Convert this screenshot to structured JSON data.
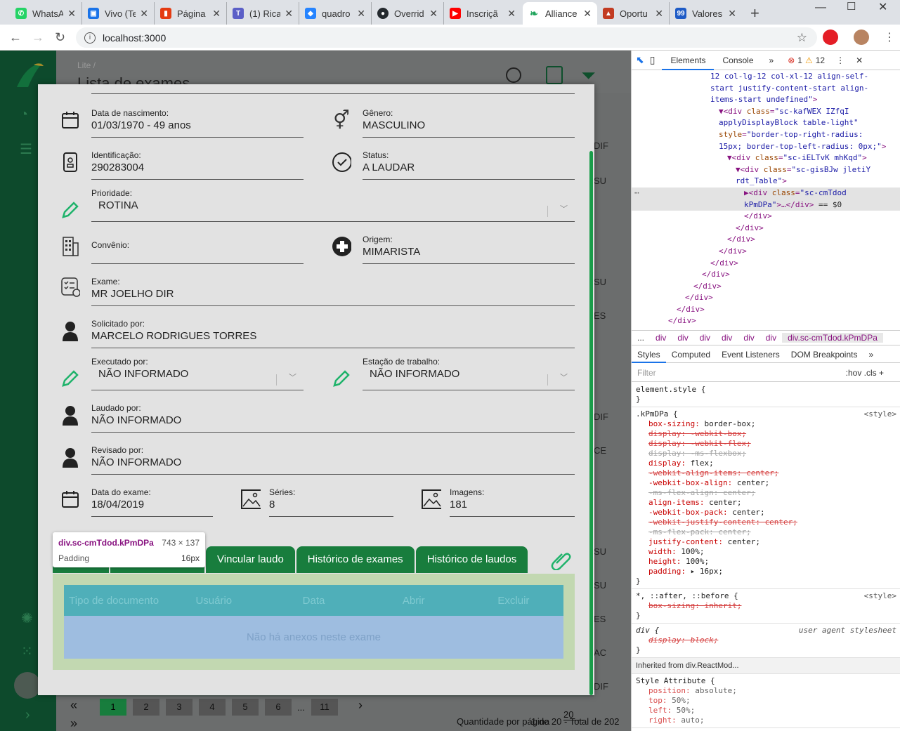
{
  "browser": {
    "tabs": [
      {
        "title": "WhatsA",
        "color": "#25d366",
        "icon": "✆"
      },
      {
        "title": "Vivo (Te",
        "color": "#1a73e8",
        "icon": "▣"
      },
      {
        "title": "Página",
        "color": "#e43b12",
        "icon": "▮"
      },
      {
        "title": "(1) Rica",
        "color": "#5b5fc7",
        "icon": "T"
      },
      {
        "title": "quadro",
        "color": "#2684ff",
        "icon": "◆"
      },
      {
        "title": "Overrid",
        "color": "#24292e",
        "icon": "●"
      },
      {
        "title": "Inscriçã",
        "color": "#ff0000",
        "icon": "▶"
      },
      {
        "title": "Alliance",
        "color": "#1ea35a",
        "icon": "❧"
      },
      {
        "title": "Oportu",
        "color": "#c23b22",
        "icon": "▲"
      },
      {
        "title": "Valores",
        "color": "#1e5bc6",
        "icon": "99"
      }
    ],
    "url": "localhost:3000"
  },
  "page": {
    "breadcrumb": "Lite /",
    "title": "Lista de exames",
    "bg_cells": [
      "DIF",
      "SU",
      "SU",
      "ES",
      "DIF",
      "CE",
      "SU",
      "SU",
      "ES",
      "AC",
      "DIF"
    ],
    "pagination": {
      "prev": "«",
      "next": "»",
      "pages": [
        "1",
        "2",
        "3",
        "4",
        "5",
        "6",
        "...",
        "11"
      ],
      "arrow": "›",
      "quantity_label": "Quantidade por página",
      "quantity_value": "20",
      "total": "1 de 20 - Total de 202"
    }
  },
  "modal": {
    "birth_label": "Data de nascimento:",
    "birth_value": "01/03/1970 - 49 anos",
    "gender_label": "Gênero:",
    "gender_value": "MASCULINO",
    "id_label": "Identificação:",
    "id_value": "290283004",
    "status_label": "Status:",
    "status_value": "A LAUDAR",
    "priority_label": "Prioridade:",
    "priority_value": "ROTINA",
    "insurance_label": "Convênio:",
    "insurance_value": "",
    "origin_label": "Origem:",
    "origin_value": "MIMARISTA",
    "exam_label": "Exame:",
    "exam_value": "MR JOELHO DIR",
    "requested_label": "Solicitado por:",
    "requested_value": "MARCELO RODRIGUES TORRES",
    "executed_label": "Executado por:",
    "executed_value": "NÃO INFORMADO",
    "station_label": "Estação de trabalho:",
    "station_value": "NÃO INFORMADO",
    "reported_label": "Laudado por:",
    "reported_value": "NÃO INFORMADO",
    "reviewed_label": "Revisado por:",
    "reviewed_value": "NÃO INFORMADO",
    "examdate_label": "Data do exame:",
    "examdate_value": "18/04/2019",
    "series_label": "Séries:",
    "series_value": "8",
    "images_label": "Imagens:",
    "images_value": "181",
    "tabs": [
      "Vincular laudo",
      "Histórico de exames",
      "Histórico de laudos"
    ],
    "attach_columns": [
      "Tipo de documento",
      "Usuário",
      "Data",
      "Abrir",
      "Excluir"
    ],
    "attach_empty": "Não há anexos neste exame"
  },
  "inspector_tooltip": {
    "name": "div.sc-cmTdod.kPmDPa",
    "dims": "743 × 137",
    "prop": "Padding",
    "value": "16px"
  },
  "devtools": {
    "tabs": [
      "Elements",
      "Console"
    ],
    "errors": "1",
    "warnings": "12",
    "breadcrumb": [
      "...",
      "div",
      "div",
      "div",
      "div",
      "div",
      "div",
      "div.sc-cmTdod.kPmDPa"
    ],
    "style_tabs": [
      "Styles",
      "Computed",
      "Event Listeners",
      "DOM Breakpoints"
    ],
    "filter_placeholder": "Filter",
    "filter_right": ":hov  .cls  +",
    "inherited": "Inherited from div.ReactMod..."
  }
}
